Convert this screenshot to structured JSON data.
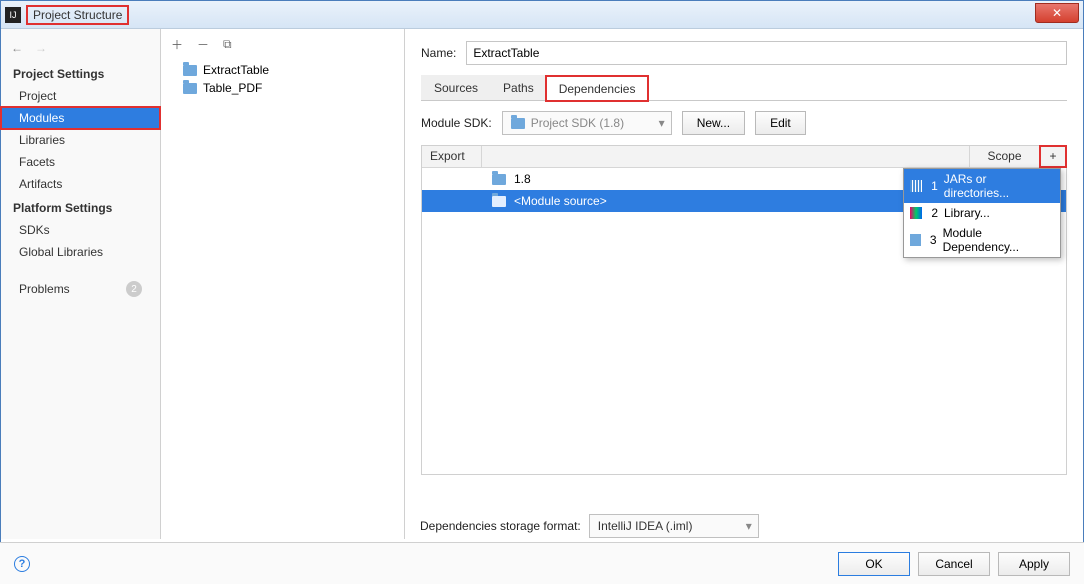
{
  "window": {
    "title": "Project Structure"
  },
  "left": {
    "section1": "Project Settings",
    "items1": [
      "Project",
      "Modules",
      "Libraries",
      "Facets",
      "Artifacts"
    ],
    "section2": "Platform Settings",
    "items2": [
      "SDKs",
      "Global Libraries"
    ],
    "problems": "Problems",
    "problems_badge": "2"
  },
  "tree": {
    "nodes": [
      "ExtractTable",
      "Table_PDF"
    ]
  },
  "right": {
    "name_label": "Name:",
    "name_value": "ExtractTable",
    "tabs": [
      "Sources",
      "Paths",
      "Dependencies"
    ],
    "sdk_label": "Module SDK:",
    "sdk_value": "Project SDK (1.8)",
    "new_btn": "New...",
    "edit_btn": "Edit",
    "col_export": "Export",
    "col_scope": "Scope",
    "add_btn": "+",
    "deps": [
      "1.8",
      "<Module source>"
    ],
    "storage_label": "Dependencies storage format:",
    "storage_value": "IntelliJ IDEA (.iml)"
  },
  "popup": {
    "items": [
      {
        "n": "1",
        "label": "JARs or directories..."
      },
      {
        "n": "2",
        "label": "Library..."
      },
      {
        "n": "3",
        "label": "Module Dependency..."
      }
    ]
  },
  "footer": {
    "ok": "OK",
    "cancel": "Cancel",
    "apply": "Apply"
  }
}
